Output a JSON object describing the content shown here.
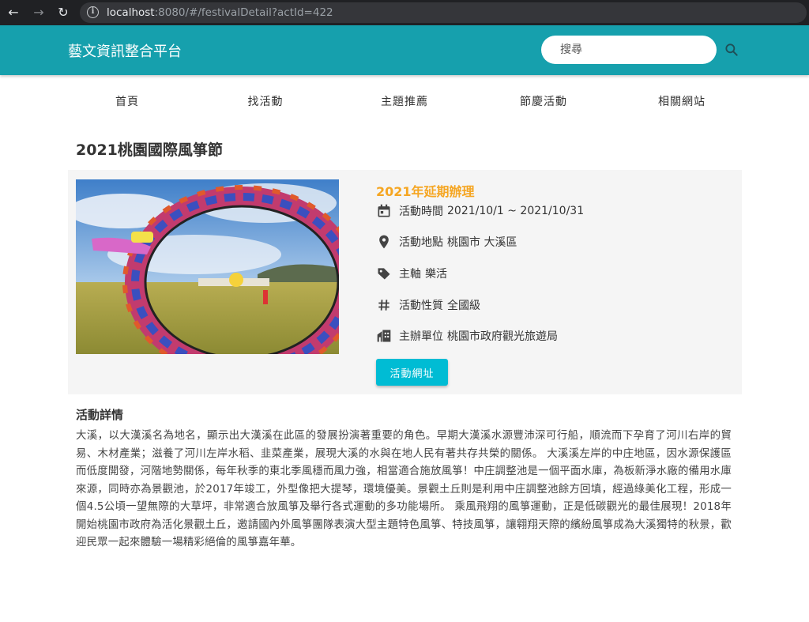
{
  "browser": {
    "back": "←",
    "forward": "→",
    "reload": "↻",
    "url_host": "localhost",
    "url_path": ":8080/#/festivalDetail?actId=422"
  },
  "header": {
    "title": "藝文資訊整合平台",
    "search_placeholder": "搜尋",
    "brand_color": "#16a0ad"
  },
  "nav": {
    "items": [
      {
        "label": "首頁"
      },
      {
        "label": "找活動"
      },
      {
        "label": "主題推薦"
      },
      {
        "label": "節慶活動"
      },
      {
        "label": "相關網站"
      }
    ]
  },
  "event": {
    "title": "2021桃園國際風箏節",
    "status": "2021年延期辦理",
    "time_label": "活動時間",
    "time_value": "2021/10/1 ~ 2021/10/31",
    "place_label": "活動地點",
    "place_value": "桃園市 大溪區",
    "theme_label": "主軸",
    "theme_value": "樂活",
    "nature_label": "活動性質",
    "nature_value": "全國級",
    "host_label": "主辦單位",
    "host_value": "桃園市政府觀光旅遊局",
    "link_button": "活動網址",
    "status_color": "#f5a623",
    "button_color": "#00bcd4"
  },
  "details": {
    "heading": "活動詳情",
    "body": "大溪，以大漢溪名為地名，顯示出大漢溪在此區的發展扮演著重要的角色。早期大漢溪水源豐沛深可行船，順流而下孕育了河川右岸的貿易、木材產業；滋養了河川左岸水稻、韭菜產業，展現大溪的水與在地人民有著共存共榮的關係。 大溪溪左岸的中庄地區，因水源保護區而低度開發，河階地勢關係，每年秋季的東北季風穩而風力強，相當適合施放風箏！中庄調整池是一個平面水庫，為板新淨水廠的備用水庫來源，同時亦為景觀池，於2017年竣工，外型像把大提琴，環境優美。景觀土丘則是利用中庄調整池餘方回填，經過綠美化工程，形成一個4.5公頃一望無際的大草坪，非常適合放風箏及舉行各式運動的多功能場所。 乘風飛翔的風箏運動，正是低碳觀光的最佳展現！2018年開始桃園市政府為活化景觀土丘，邀請國內外風箏團隊表演大型主題特色風箏、特技風箏，讓翱翔天際的繽紛風箏成為大溪獨特的秋景，歡迎民眾一起來體驗一場精彩絕倫的風箏嘉年華。"
  }
}
